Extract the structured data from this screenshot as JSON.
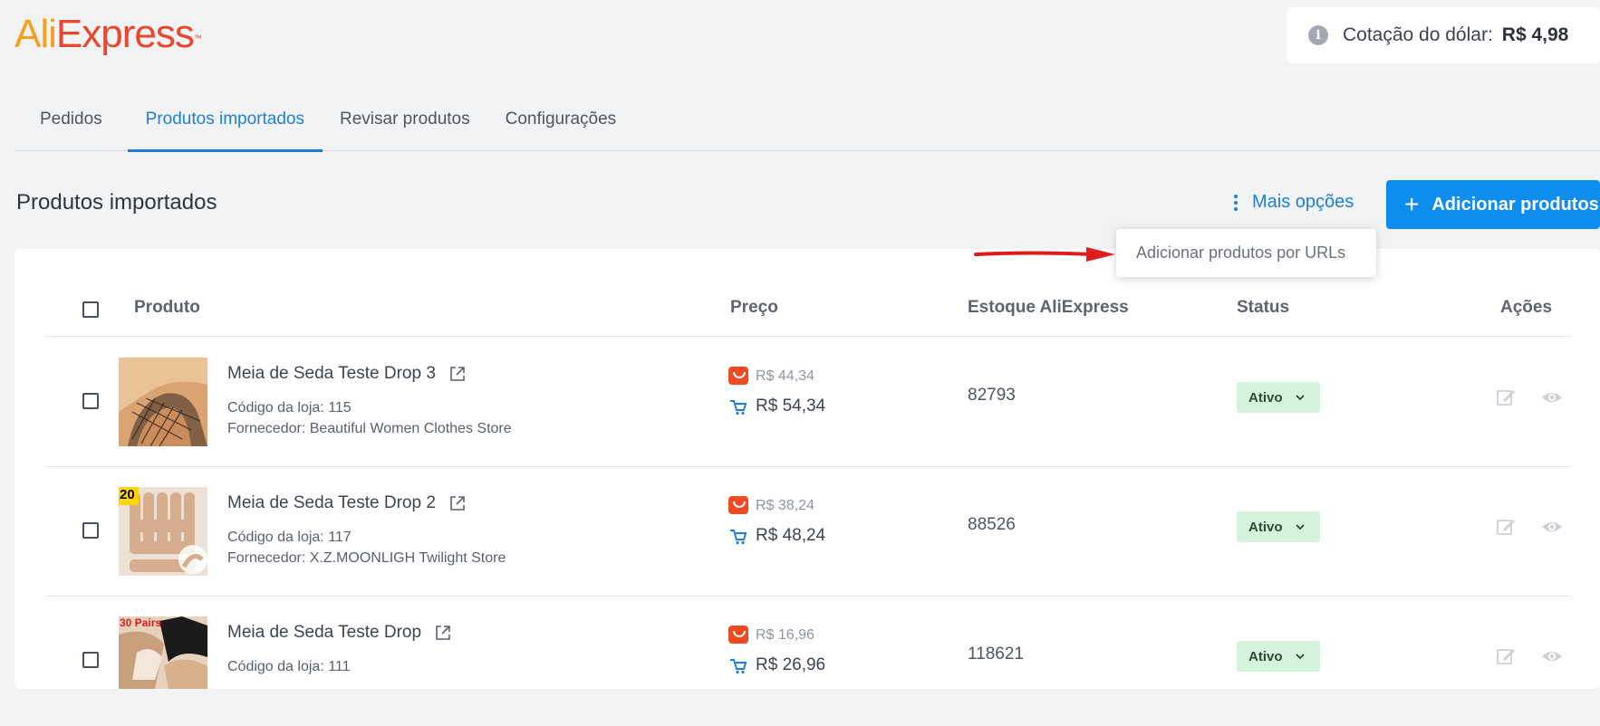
{
  "header": {
    "logo_ali": "Ali",
    "logo_express": "Express",
    "logo_tm": "™",
    "rate_label": "Cotação do dólar:",
    "rate_value": "R$ 4,98"
  },
  "tabs": [
    {
      "label": "Pedidos",
      "active": false
    },
    {
      "label": "Produtos importados",
      "active": true
    },
    {
      "label": "Revisar produtos",
      "active": false
    },
    {
      "label": "Configurações",
      "active": false
    }
  ],
  "section": {
    "title": "Produtos importados",
    "more_options": "Mais opções",
    "add_button": "Adicionar produtos",
    "dropdown_item": "Adicionar produtos por URLs"
  },
  "table": {
    "columns": {
      "product": "Produto",
      "price": "Preço",
      "stock": "Estoque AliExpress",
      "status": "Status",
      "actions": "Ações"
    },
    "rows": [
      {
        "name": "Meia de Seda Teste Drop 3",
        "store_code": "Código da loja: 115",
        "supplier": "Fornecedor: Beautiful Women Clothes Store",
        "price_original": "R$ 44,34",
        "price_sale": "R$ 54,34",
        "stock": "82793",
        "status": "Ativo"
      },
      {
        "name": "Meia de Seda Teste Drop 2",
        "store_code": "Código da loja: 117",
        "supplier": "Fornecedor: X.Z.MOONLIGH Twilight Store",
        "price_original": "R$ 38,24",
        "price_sale": "R$ 48,24",
        "stock": "88526",
        "status": "Ativo",
        "thumb_badge": "20"
      },
      {
        "name": "Meia de Seda Teste Drop",
        "store_code": "Código da loja: 111",
        "supplier": "",
        "price_original": "R$ 16,96",
        "price_sale": "R$ 26,96",
        "stock": "118621",
        "status": "Ativo",
        "thumb_badge": "30 Pairs"
      }
    ]
  },
  "colors": {
    "accent": "#0d8df0",
    "active_tab": "#1d7fd8",
    "status_bg": "#d5f2da",
    "arrow": "#e01b1b"
  }
}
